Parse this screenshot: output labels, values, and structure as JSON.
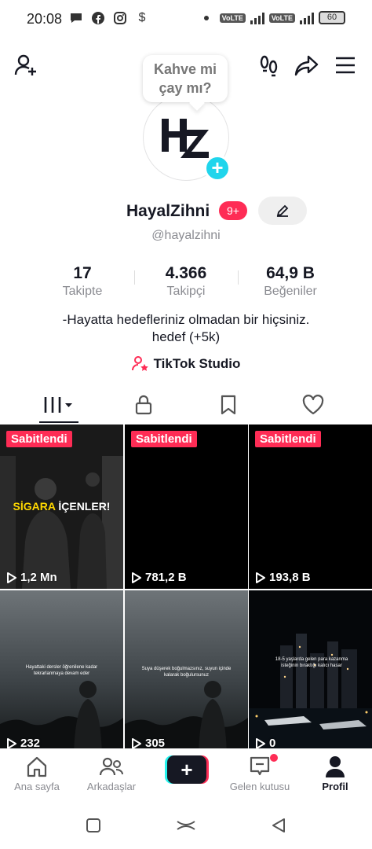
{
  "status_bar": {
    "time": "20:08",
    "volte1": "VoLTE",
    "volte2": "VoLTE",
    "battery": "60",
    "icons": [
      "message-icon",
      "facebook-icon",
      "instagram-icon",
      "dollar-icon"
    ]
  },
  "profile": {
    "bubble_text": "Kahve mi çay mı?",
    "username": "HayalZihni",
    "badge": "9+",
    "handle": "@hayalzihni",
    "avatar_logo": "HZ"
  },
  "stats": [
    {
      "value": "17",
      "label": "Takipte"
    },
    {
      "value": "4.366",
      "label": "Takipçi"
    },
    {
      "value": "64,9 B",
      "label": "Beğeniler"
    }
  ],
  "bio": {
    "line1": "-Hayatta hedefleriniz olmadan bir hiçsiniz.",
    "line2": "hedef (+5k)"
  },
  "studio_link": "TikTok Studio",
  "tabs": [
    "videos-grid-icon",
    "lock-icon",
    "bookmark-icon",
    "heart-icon"
  ],
  "videos": [
    {
      "pinned": "Sabitlendi",
      "views": "1,2 Mn",
      "headline_a": "SİGARA",
      "headline_b": " İÇENLER!"
    },
    {
      "pinned": "Sabitlendi",
      "views": "781,2 B"
    },
    {
      "pinned": "Sabitlendi",
      "views": "193,8 B"
    },
    {
      "views": "232",
      "caption": "Hayattaki dersler öğrenilene kadar tekrarlanmaya devam eder"
    },
    {
      "views": "305",
      "caption": "Suya düşerek boğulmazsınız, suyun içinde kalarak boğulursunuz"
    },
    {
      "views": "0",
      "caption": "18-5 yaşlarda gelen para kazanma isteğinin bıraktığı kalıcı hasar"
    }
  ],
  "bottom_nav": {
    "home": "Ana sayfa",
    "friends": "Arkadaşlar",
    "create": "+",
    "inbox": "Gelen kutusu",
    "profile": "Profil"
  },
  "colors": {
    "accent": "#fe2c55",
    "cyan": "#25f4ee",
    "text": "#161823",
    "muted": "#8a8b91"
  }
}
